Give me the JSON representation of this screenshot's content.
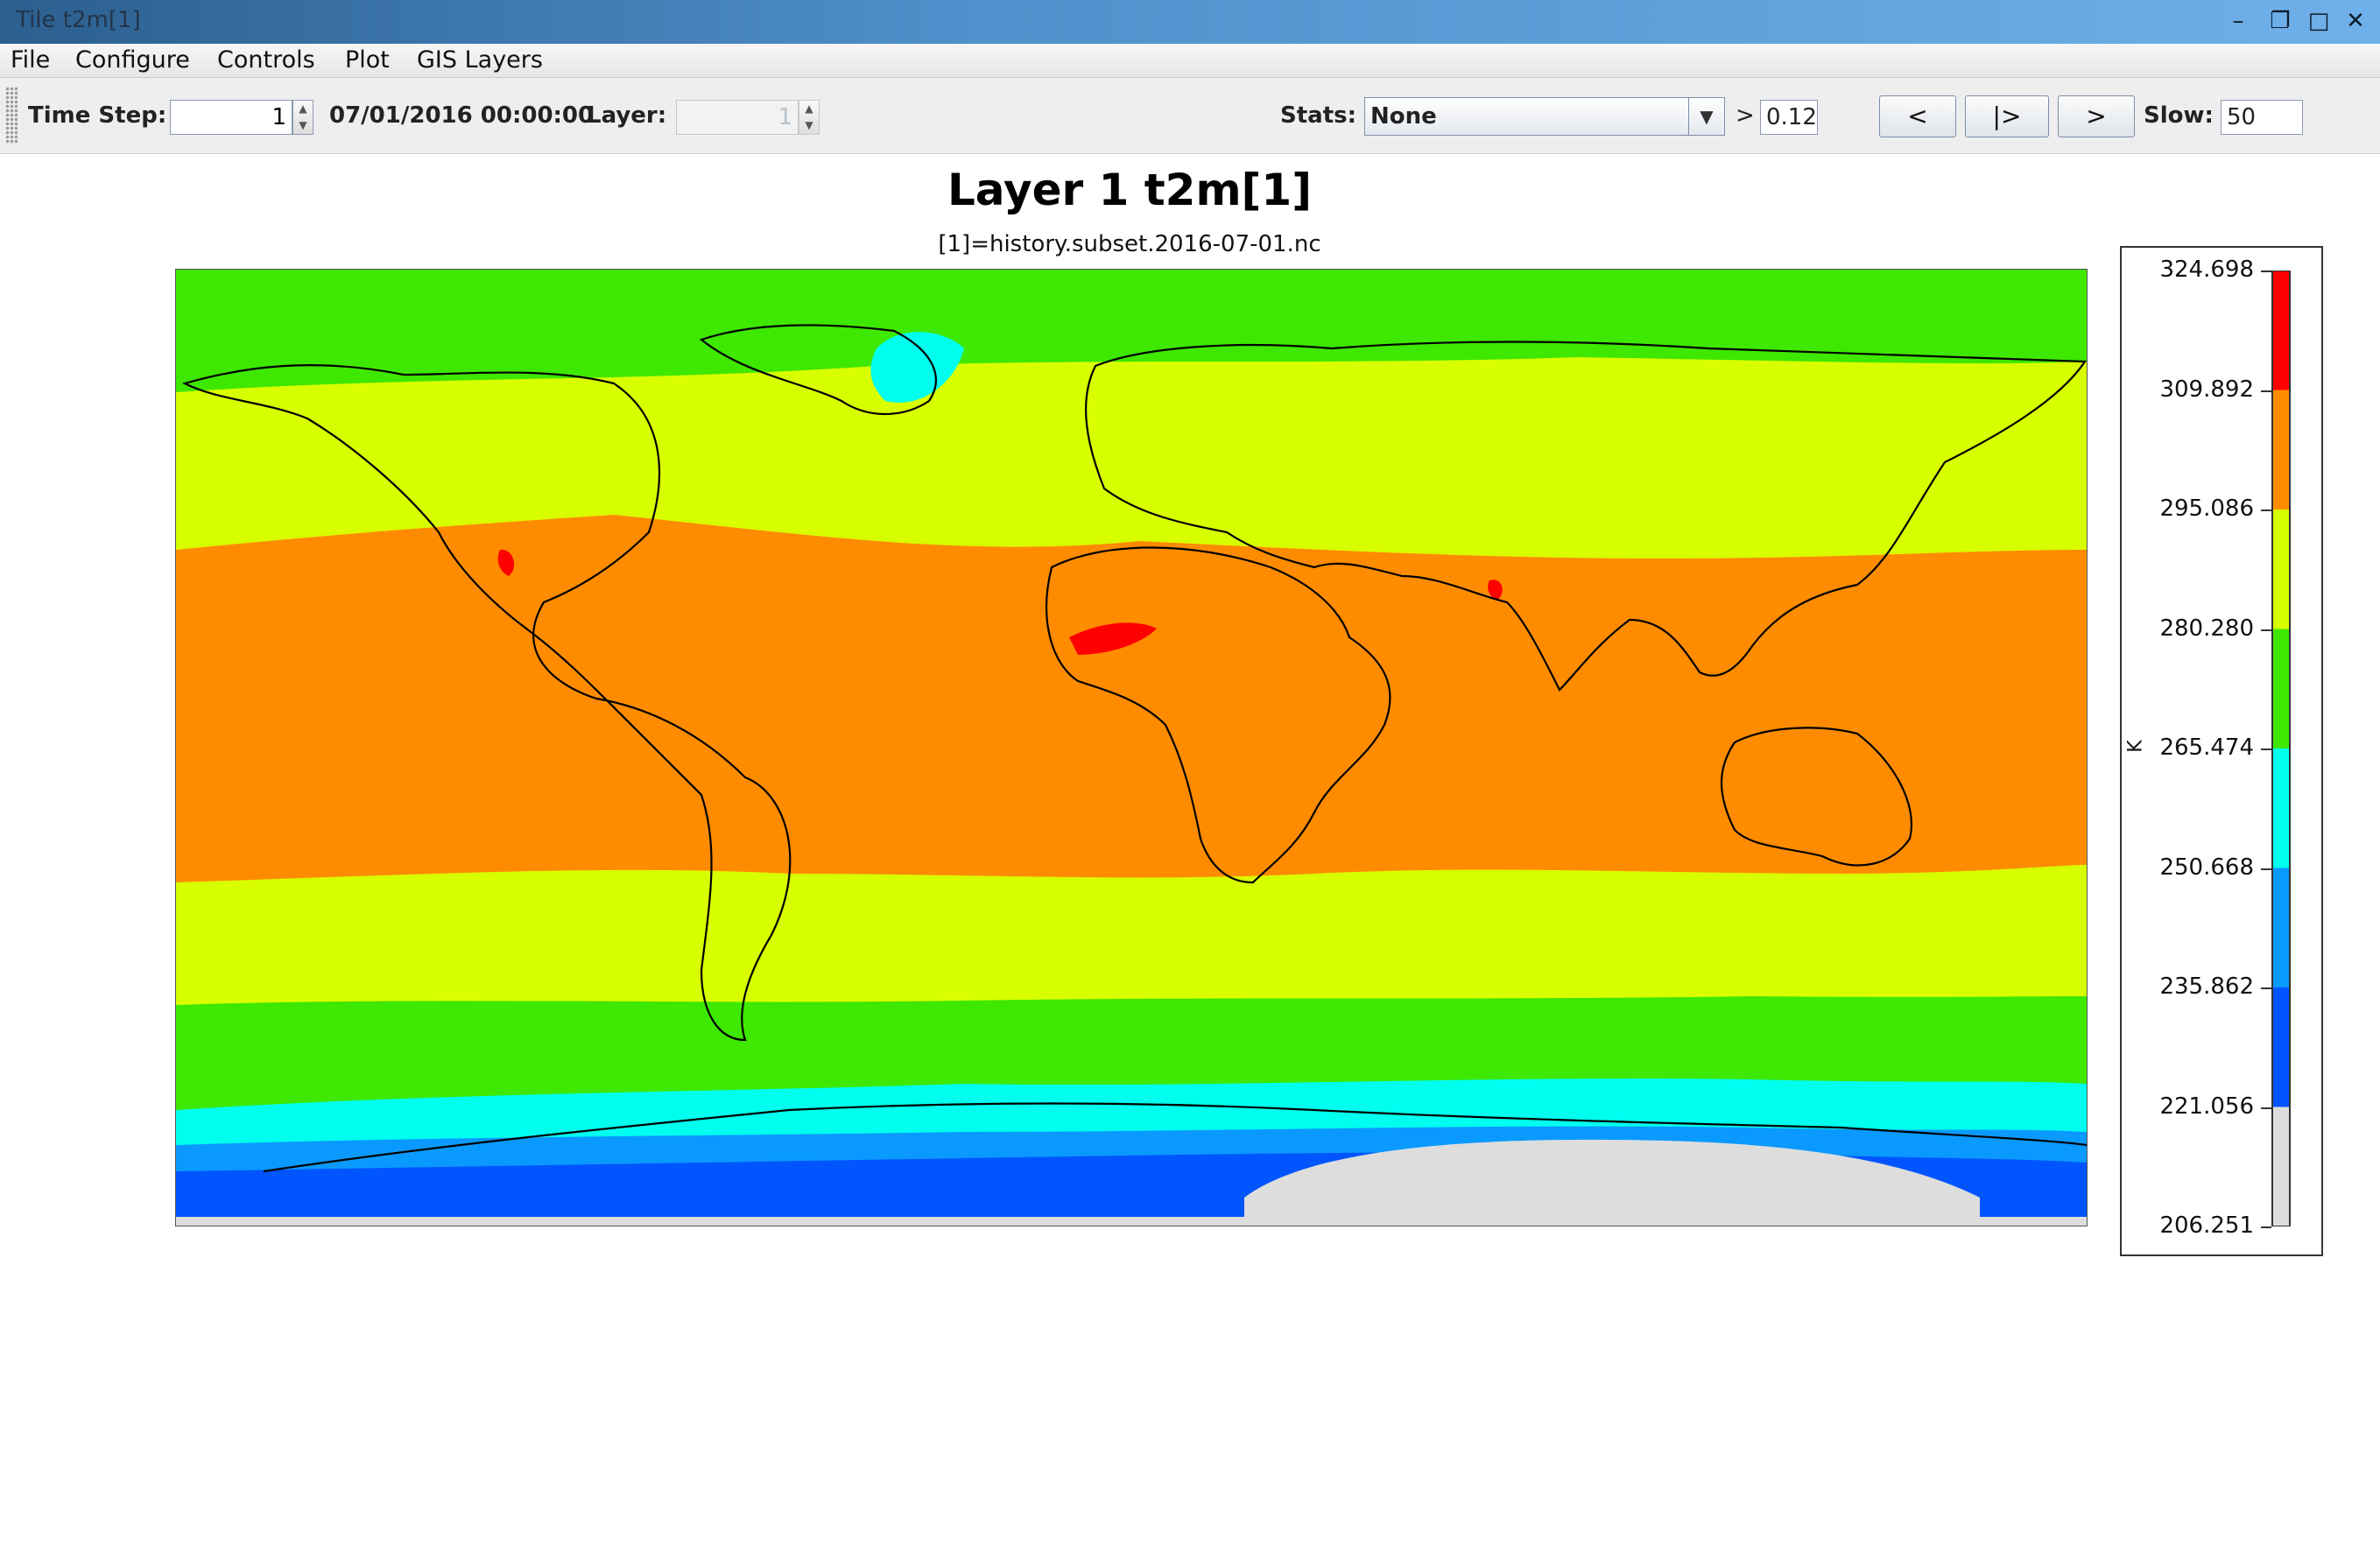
{
  "window": {
    "title": "Tile t2m[1]",
    "controls": [
      "minimize-icon",
      "restore-icon",
      "maximize-icon",
      "close-icon"
    ]
  },
  "menu": {
    "items": [
      "File",
      "Configure",
      "Controls",
      "Plot",
      "GIS Layers"
    ]
  },
  "toolbar": {
    "time_step_label": "Time Step:",
    "time_step_value": "1",
    "datetime": "07/01/2016 00:00:00",
    "layer_label": "Layer:",
    "layer_value": "1",
    "stats_label": "Stats:",
    "stats_value": "None",
    "threshold_symbol": ">",
    "threshold_value": "0.12",
    "prev_button": "<",
    "play_button": "|>",
    "next_button": ">",
    "slow_label": "Slow:",
    "slow_value": "50"
  },
  "plot": {
    "title": "Layer 1 t2m[1]",
    "subtitle": "[1]=history.subset.2016-07-01.nc"
  },
  "legend": {
    "unit": "K",
    "ticks": [
      "324.698",
      "309.892",
      "295.086",
      "280.280",
      "265.474",
      "250.668",
      "235.862",
      "221.056",
      "206.251"
    ],
    "colors": [
      "#ff0000",
      "#ff8c00",
      "#d8ff00",
      "#3ee800",
      "#00ffee",
      "#0a9aff",
      "#0055ff",
      "#dddddd"
    ]
  },
  "colors": {
    "bin_324_310": "#ff0000",
    "bin_310_295": "#ff8c00",
    "bin_295_280": "#d8ff00",
    "bin_280_265": "#3ee800",
    "bin_265_251": "#00ffee",
    "bin_251_236": "#0a9aff",
    "bin_236_221": "#0055ff",
    "bin_221_206": "#dddddd"
  }
}
